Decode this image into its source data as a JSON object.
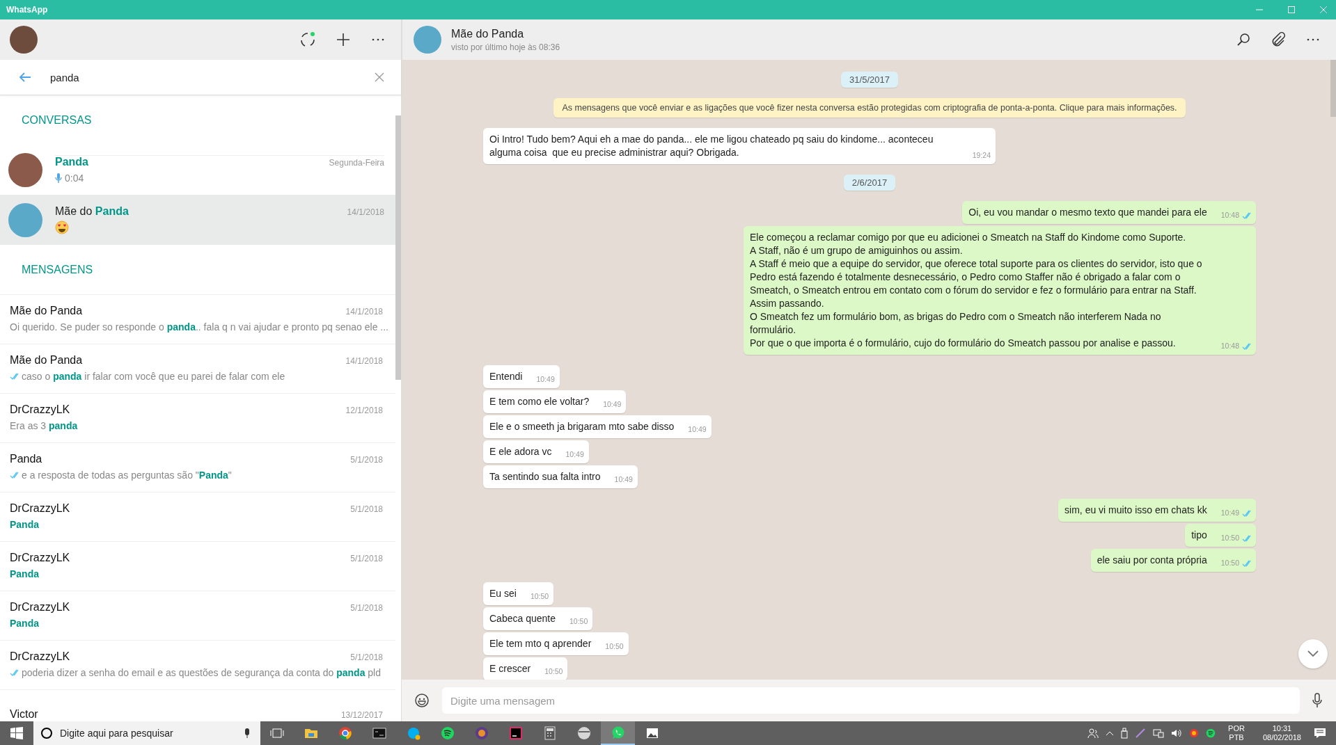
{
  "window": {
    "title": "WhatsApp"
  },
  "search": {
    "value": "panda"
  },
  "sections": [
    {
      "title": "CONVERSAS",
      "kind": "conversations",
      "items": [
        {
          "name": "Panda",
          "highlighted": true,
          "date": "Segunda-Feira",
          "kind": "voice",
          "preview": "0:04",
          "selected": false
        },
        {
          "name": "Mãe do **Panda**",
          "highlighted": false,
          "date": "14/1/2018",
          "kind": "emoji",
          "selected": true
        }
      ]
    },
    {
      "title": "MENSAGENS",
      "kind": "messages",
      "items": [
        {
          "name": "Mãe do Panda",
          "date": "14/1/2018",
          "ticks": false,
          "highlighted": false,
          "preview": "Oi querido. Se puder so responde o **panda**.. fala q n vai ajudar e pronto pq senao ele ..."
        },
        {
          "name": "Mãe do Panda",
          "date": "14/1/2018",
          "ticks": true,
          "highlighted": false,
          "preview": "caso o **panda** ir falar com você que eu parei de falar com ele"
        },
        {
          "name": "DrCrazzyLK",
          "date": "12/1/2018",
          "ticks": false,
          "highlighted": false,
          "preview": "Era as 3 **panda**"
        },
        {
          "name": "Panda",
          "date": "5/1/2018",
          "ticks": true,
          "highlighted": false,
          "preview": "e a resposta de todas as perguntas são \"**Panda**\""
        },
        {
          "name": "DrCrazzyLK",
          "date": "5/1/2018",
          "ticks": false,
          "highlighted": true,
          "preview": "Panda"
        },
        {
          "name": "DrCrazzyLK",
          "date": "5/1/2018",
          "ticks": false,
          "highlighted": true,
          "preview": "Panda"
        },
        {
          "name": "DrCrazzyLK",
          "date": "5/1/2018",
          "ticks": false,
          "highlighted": true,
          "preview": "Panda"
        },
        {
          "name": "DrCrazzyLK",
          "date": "5/1/2018",
          "ticks": true,
          "highlighted": false,
          "preview": "poderia dizer a senha do email e as questões de segurança da conta do **panda** pld"
        },
        {
          "name": "Victor",
          "date": "13/12/2017",
          "ticks": false
        }
      ]
    }
  ],
  "chat": {
    "name": "Mãe do Panda",
    "status": "visto por último hoje às 08:36"
  },
  "messages": [
    {
      "kind": "date",
      "text": "31/5/2017"
    },
    {
      "kind": "system",
      "text": "As mensagens que você enviar e as ligações que você fizer nesta conversa estão protegidas com criptografia de ponta-a-ponta. Clique para mais informações."
    },
    {
      "kind": "in",
      "text": "Oi Intro! Tudo bem? Aqui eh a mae do panda... ele me ligou chateado pq saiu do kindome... aconteceu alguma coisa  que eu precise administrar aqui? Obrigada.",
      "time": "19:24"
    },
    {
      "kind": "date",
      "text": "2/6/2017"
    },
    {
      "kind": "out",
      "text": "Oi, eu vou mandar o mesmo texto que mandei para ele",
      "time": "10:48",
      "ticks": true
    },
    {
      "kind": "out",
      "text": "Ele começou a reclamar comigo por que eu adicionei o Smeatch na Staff do Kindome como Suporte.\nA Staff, não é um grupo de amiguinhos ou assim.\nA Staff é meio que a equipe do servidor, que oferece total suporte para os clientes do servidor, isto que o Pedro está fazendo é totalmente desnecessário, o Pedro como Staffer não é obrigado a falar com o Smeatch, o Smeatch entrou em contato com o fórum do servidor e fez o formulário para entrar na Staff.\nAssim passando.\nO Smeatch fez um formulário bom, as brigas do Pedro com o Smeatch não interferem Nada no formulário.\nPor que o que importa é o formulário, cujo do formulário do Smeatch passou por analise e passou.",
      "time": "10:48",
      "ticks": true
    },
    {
      "kind": "in",
      "text": "Entendi",
      "time": "10:49"
    },
    {
      "kind": "in",
      "text": "E tem como ele voltar?",
      "time": "10:49"
    },
    {
      "kind": "in",
      "text": "Ele e o smeeth ja brigaram mto sabe disso",
      "time": "10:49"
    },
    {
      "kind": "in",
      "text": "E ele adora vc",
      "time": "10:49"
    },
    {
      "kind": "in",
      "text": "Ta sentindo sua falta intro",
      "time": "10:49"
    },
    {
      "kind": "out",
      "text": "sim, eu vi muito isso em chats kk",
      "time": "10:49",
      "ticks": true
    },
    {
      "kind": "out",
      "text": "tipo",
      "time": "10:50",
      "ticks": true
    },
    {
      "kind": "out",
      "text": "ele saiu por conta própria",
      "time": "10:50",
      "ticks": true
    },
    {
      "kind": "in",
      "text": "Eu sei",
      "time": "10:50"
    },
    {
      "kind": "in",
      "text": "Cabeca quente",
      "time": "10:50"
    },
    {
      "kind": "in",
      "text": "Ele tem mto q aprender",
      "time": "10:50"
    },
    {
      "kind": "in",
      "text": "E crescer",
      "time": "10:50"
    }
  ],
  "composer": {
    "placeholder": "Digite uma mensagem"
  },
  "taskbar": {
    "search_placeholder": "Digite aqui para pesquisar",
    "apps": [
      {
        "kind": "folder",
        "active": false
      },
      {
        "kind": "chrome",
        "active": false
      },
      {
        "kind": "terminal",
        "active": false
      },
      {
        "kind": "skype",
        "active": false
      },
      {
        "kind": "spotify",
        "active": false
      },
      {
        "kind": "game",
        "active": false
      },
      {
        "kind": "ide",
        "active": false
      },
      {
        "kind": "calculator",
        "active": false
      },
      {
        "kind": "disc",
        "active": false
      },
      {
        "kind": "whatsapp",
        "active": true
      },
      {
        "kind": "photos",
        "active": false
      }
    ],
    "language": "POR",
    "layout": "PTB",
    "time": "10:31",
    "date": "08/02/2018"
  }
}
